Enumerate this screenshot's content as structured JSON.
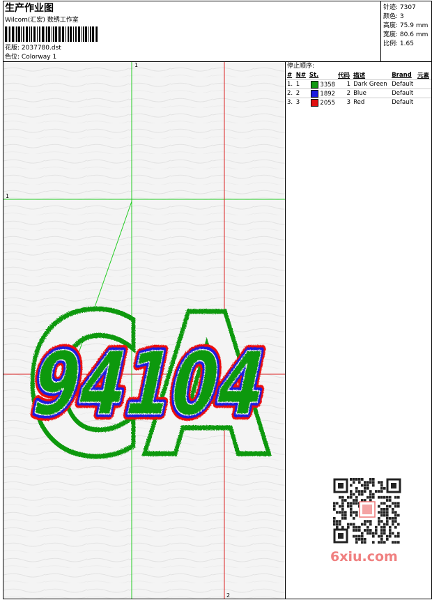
{
  "header": {
    "title": "生产作业图",
    "company": "Wilcom(汇宏) 数绣工作室",
    "design_label": "花版:",
    "design_value": "2037780.dst",
    "colorway_label": "色位:",
    "colorway_value": "Colorway 1"
  },
  "stats": {
    "stitches_label": "针迹:",
    "stitches_value": "7307",
    "colors_label": "颜色:",
    "colors_value": "3",
    "height_label": "高度:",
    "height_value": "75.9 mm",
    "width_label": "宽度:",
    "width_value": "80.6 mm",
    "ratio_label": "比例:",
    "ratio_value": "1.65"
  },
  "stop_sequence": {
    "title": "停止顺序:",
    "headers": [
      "#",
      "N#",
      "St.",
      "代码",
      "描述",
      "Brand",
      "元素"
    ],
    "rows": [
      {
        "idx": "1.",
        "n": "1",
        "color": "#119911",
        "st": "3358",
        "code": "1",
        "desc": "Dark Green",
        "brand": "Default"
      },
      {
        "idx": "2.",
        "n": "2",
        "color": "#1a1ae0",
        "st": "1892",
        "code": "2",
        "desc": "Blue",
        "brand": "Default"
      },
      {
        "idx": "3.",
        "n": "3",
        "color": "#e01010",
        "st": "2055",
        "code": "3",
        "desc": "Red",
        "brand": "Default"
      }
    ]
  },
  "design": {
    "outline_text": "CA",
    "number_text": "94104",
    "colors": {
      "green": "#119911",
      "blue": "#1a1ae0",
      "red": "#ee1111"
    }
  },
  "guides": {
    "top_label": "1",
    "left_label": "1",
    "bottom_label": "2",
    "green": "#22cc22",
    "red": "#dd2222"
  },
  "watermark": {
    "text": "6xiu.com"
  }
}
